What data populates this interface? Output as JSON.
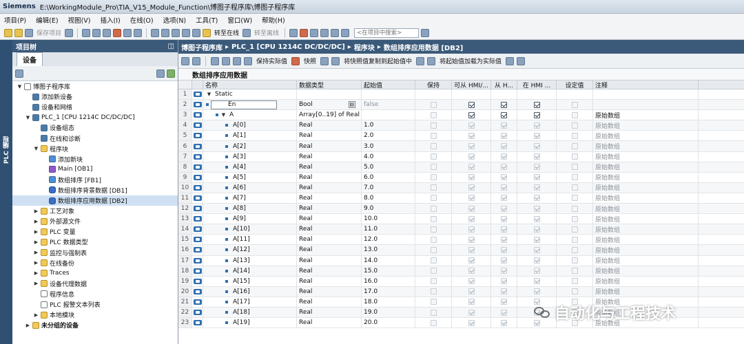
{
  "window": {
    "app": "Siemens",
    "path": "E:\\WorkingModule_Pro\\TIA_V15_Module_Function\\博图子程序库\\博图子程序库"
  },
  "menu": [
    "项目(P)",
    "编辑(E)",
    "视图(V)",
    "插入(I)",
    "在线(O)",
    "选项(N)",
    "工具(T)",
    "窗口(W)",
    "帮助(H)"
  ],
  "toolbar": {
    "save_project": "保存项目",
    "go_online": "转至在线",
    "go_offline": "转至离线",
    "search_placeholder": "<在项目中搜索>"
  },
  "portal_tab": "PLC 编程",
  "tree": {
    "header": "项目树",
    "tab": "设备",
    "items": [
      {
        "label": "博图子程序库",
        "level": 0,
        "toggle": "▼",
        "icon": "doc"
      },
      {
        "label": "添加新设备",
        "level": 1,
        "toggle": "",
        "icon": "plc"
      },
      {
        "label": "设备和网络",
        "level": 1,
        "toggle": "",
        "icon": "plc"
      },
      {
        "label": "PLC_1 [CPU 1214C DC/DC/DC]",
        "level": 1,
        "toggle": "▼",
        "icon": "plc"
      },
      {
        "label": "设备组态",
        "level": 2,
        "toggle": "",
        "icon": "plc"
      },
      {
        "label": "在线和诊断",
        "level": 2,
        "toggle": "",
        "icon": "plc"
      },
      {
        "label": "程序块",
        "level": 2,
        "toggle": "▼",
        "icon": "folder"
      },
      {
        "label": "添加新块",
        "level": 3,
        "toggle": "",
        "icon": "fb"
      },
      {
        "label": "Main [OB1]",
        "level": 3,
        "toggle": "",
        "icon": "ob"
      },
      {
        "label": "数组排序 [FB1]",
        "level": 3,
        "toggle": "",
        "icon": "fb"
      },
      {
        "label": "数组排序背景数据 [DB1]",
        "level": 3,
        "toggle": "",
        "icon": "db"
      },
      {
        "label": "数组排序应用数据 [DB2]",
        "level": 3,
        "toggle": "",
        "icon": "db",
        "selected": true
      },
      {
        "label": "工艺对象",
        "level": 2,
        "toggle": "▶",
        "icon": "folder"
      },
      {
        "label": "外部源文件",
        "level": 2,
        "toggle": "▶",
        "icon": "folder"
      },
      {
        "label": "PLC 变量",
        "level": 2,
        "toggle": "▶",
        "icon": "folder"
      },
      {
        "label": "PLC 数据类型",
        "level": 2,
        "toggle": "▶",
        "icon": "folder"
      },
      {
        "label": "监控与强制表",
        "level": 2,
        "toggle": "▶",
        "icon": "folder"
      },
      {
        "label": "在线备份",
        "level": 2,
        "toggle": "▶",
        "icon": "folder"
      },
      {
        "label": "Traces",
        "level": 2,
        "toggle": "▶",
        "icon": "folder"
      },
      {
        "label": "设备代理数据",
        "level": 2,
        "toggle": "▶",
        "icon": "folder"
      },
      {
        "label": "程序信息",
        "level": 2,
        "toggle": "",
        "icon": "doc"
      },
      {
        "label": "PLC 报警文本列表",
        "level": 2,
        "toggle": "",
        "icon": "doc"
      },
      {
        "label": "本地模块",
        "level": 2,
        "toggle": "▶",
        "icon": "folder"
      },
      {
        "label": "未分组的设备",
        "level": 1,
        "toggle": "▶",
        "icon": "folder",
        "bold": true
      }
    ]
  },
  "breadcrumb": [
    "博图子程序库",
    "PLC_1 [CPU 1214C DC/DC/DC]",
    "程序块",
    "数组排序应用数据 [DB2]"
  ],
  "editor_toolbar": {
    "keep_actual": "保持实际值",
    "snapshot": "快照",
    "copy_snapshot": "将快照值复制到起始值中",
    "load_start": "将起始值加载为实际值"
  },
  "block_title": "数组排序应用数据",
  "columns": {
    "name": "名称",
    "type": "数据类型",
    "start": "起始值",
    "retain": "保持",
    "hmi_access": "可从 HMI/...",
    "hmi_visible": "从 H...",
    "hmi_setpoint": "在 HMI ...",
    "setpoint": "设定值",
    "comment": "注释"
  },
  "rows": [
    {
      "n": "1",
      "name": "Static",
      "toggle": "▼",
      "type": "",
      "start": "",
      "retain": null,
      "hmi": null,
      "vis": null,
      "hmiset": null,
      "set": null,
      "comment": ""
    },
    {
      "n": "2",
      "name": "En",
      "toggle": "",
      "type": "Bool",
      "start": "false",
      "retain": false,
      "hmi": true,
      "vis": true,
      "hmiset": true,
      "set": false,
      "comment": "",
      "editing": true
    },
    {
      "n": "3",
      "name": "A",
      "toggle": "▼",
      "type": "Array[0..19] of Real",
      "start": "",
      "retain": false,
      "hmi": true,
      "vis": true,
      "hmiset": true,
      "set": false,
      "comment": "原始数组"
    },
    {
      "n": "4",
      "name": "A[0]",
      "type": "Real",
      "start": "1.0",
      "comment": "原始数组"
    },
    {
      "n": "5",
      "name": "A[1]",
      "type": "Real",
      "start": "2.0",
      "comment": "原始数组"
    },
    {
      "n": "6",
      "name": "A[2]",
      "type": "Real",
      "start": "3.0",
      "comment": "原始数组"
    },
    {
      "n": "7",
      "name": "A[3]",
      "type": "Real",
      "start": "4.0",
      "comment": "原始数组"
    },
    {
      "n": "8",
      "name": "A[4]",
      "type": "Real",
      "start": "5.0",
      "comment": "原始数组"
    },
    {
      "n": "9",
      "name": "A[5]",
      "type": "Real",
      "start": "6.0",
      "comment": "原始数组"
    },
    {
      "n": "10",
      "name": "A[6]",
      "type": "Real",
      "start": "7.0",
      "comment": "原始数组"
    },
    {
      "n": "11",
      "name": "A[7]",
      "type": "Real",
      "start": "8.0",
      "comment": "原始数组"
    },
    {
      "n": "12",
      "name": "A[8]",
      "type": "Real",
      "start": "9.0",
      "comment": "原始数组"
    },
    {
      "n": "13",
      "name": "A[9]",
      "type": "Real",
      "start": "10.0",
      "comment": "原始数组"
    },
    {
      "n": "14",
      "name": "A[10]",
      "type": "Real",
      "start": "11.0",
      "comment": "原始数组"
    },
    {
      "n": "15",
      "name": "A[11]",
      "type": "Real",
      "start": "12.0",
      "comment": "原始数组"
    },
    {
      "n": "16",
      "name": "A[12]",
      "type": "Real",
      "start": "13.0",
      "comment": "原始数组"
    },
    {
      "n": "17",
      "name": "A[13]",
      "type": "Real",
      "start": "14.0",
      "comment": "原始数组"
    },
    {
      "n": "18",
      "name": "A[14]",
      "type": "Real",
      "start": "15.0",
      "comment": "原始数组"
    },
    {
      "n": "19",
      "name": "A[15]",
      "type": "Real",
      "start": "16.0",
      "comment": "原始数组"
    },
    {
      "n": "20",
      "name": "A[16]",
      "type": "Real",
      "start": "17.0",
      "comment": "原始数组"
    },
    {
      "n": "21",
      "name": "A[17]",
      "type": "Real",
      "start": "18.0",
      "comment": "原始数组"
    },
    {
      "n": "22",
      "name": "A[18]",
      "type": "Real",
      "start": "19.0",
      "comment": "原始数组"
    },
    {
      "n": "23",
      "name": "A[19]",
      "type": "Real",
      "start": "20.0",
      "comment": "原始数组"
    }
  ],
  "watermark": "自动化与工程技术",
  "colors": {
    "panel_header": "#3b5a7a",
    "portal": "#2f5072",
    "selection": "#cfe0f2"
  }
}
